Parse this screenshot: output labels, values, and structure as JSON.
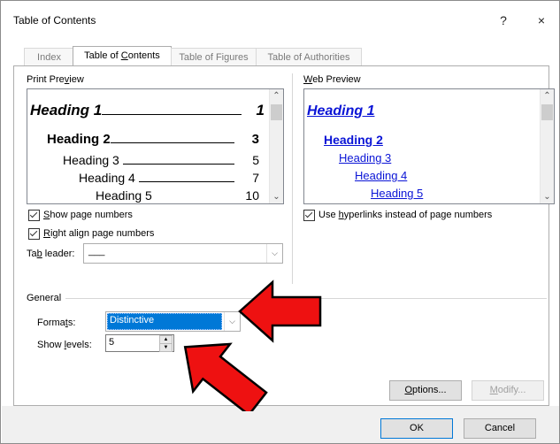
{
  "dialog": {
    "title": "Table of Contents",
    "help": "?",
    "close": "×"
  },
  "tabs": [
    {
      "label": "Index",
      "active": false
    },
    {
      "label": "Table of Contents",
      "active": true
    },
    {
      "label": "Table of Figures",
      "active": false
    },
    {
      "label": "Table of Authorities",
      "active": false
    }
  ],
  "print_preview": {
    "label": "Print Preview",
    "lines": [
      {
        "text": "Heading 1",
        "page": "1"
      },
      {
        "text": "Heading 2",
        "page": "3"
      },
      {
        "text": "Heading 3",
        "page": "5"
      },
      {
        "text": "Heading 4",
        "page": "7"
      },
      {
        "text": "Heading 5",
        "page": "10"
      }
    ],
    "show_page_numbers": "Show page numbers",
    "right_align": "Right align page numbers",
    "tab_leader_label": "Tab leader:",
    "tab_leader_value": "___"
  },
  "web_preview": {
    "label": "Web Preview",
    "lines": [
      "Heading 1",
      "Heading 2",
      "Heading 3",
      "Heading 4",
      "Heading 5"
    ],
    "use_hyperlinks": "Use hyperlinks instead of page numbers"
  },
  "general": {
    "label": "General",
    "formats_label": "Formats:",
    "formats_value": "Distinctive",
    "show_levels_label": "Show levels:",
    "show_levels_value": "5"
  },
  "buttons": {
    "options": "Options...",
    "modify": "Modify...",
    "ok": "OK",
    "cancel": "Cancel"
  },
  "colors": {
    "selection": "#0078d7",
    "hyperlink": "#0a14d6",
    "arrow_fill": "#ee1111"
  }
}
